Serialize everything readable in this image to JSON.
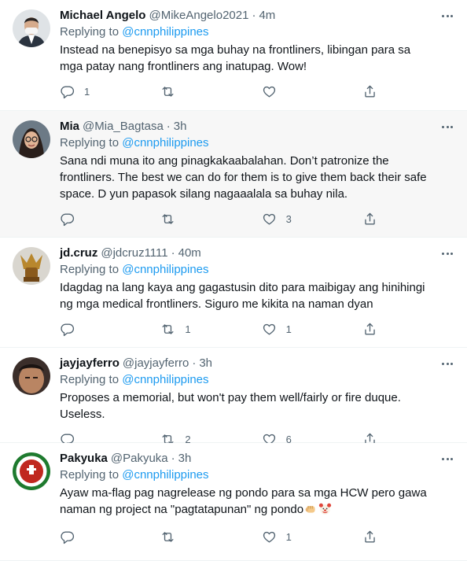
{
  "tweets": [
    {
      "name": "Michael Angelo",
      "handle": "@MikeAngelo2021",
      "sep": "·",
      "time": "4m",
      "replying_prefix": "Replying to ",
      "replying_to": "@cnnphilippines",
      "text": "Instead na benepisyo sa mga buhay na frontliners, libingan para sa mga patay nang frontliners ang inatupag. Wow!",
      "replies": "1",
      "retweets": "",
      "likes": ""
    },
    {
      "name": "Mia",
      "handle": "@Mia_Bagtasa",
      "sep": "·",
      "time": "3h",
      "replying_prefix": "Replying to ",
      "replying_to": "@cnnphilippines",
      "text": "Sana ndi muna ito ang pinagkakaabalahan. Don’t patronize the frontliners. The best we can do for them is to give them back their safe space. D yun papasok silang nagaaalala sa buhay nila.",
      "replies": "",
      "retweets": "",
      "likes": "3"
    },
    {
      "name": "jd.cruz",
      "handle": "@jdcruz1111",
      "sep": "·",
      "time": "40m",
      "replying_prefix": "Replying to ",
      "replying_to": "@cnnphilippines",
      "text": "Idagdag na lang kaya ang gagastusin dito para maibigay ang hinihingi ng mga medical frontliners. Siguro me kikita na naman dyan",
      "replies": "",
      "retweets": "1",
      "likes": "1"
    },
    {
      "name": "jayjayferro",
      "handle": "@jayjayferro",
      "sep": "·",
      "time": "3h",
      "replying_prefix": "Replying to ",
      "replying_to": "@cnnphilippines",
      "text": "Proposes a memorial, but won't pay them well/fairly or fire duque. Useless.",
      "replies": "",
      "retweets": "2",
      "likes": "6"
    },
    {
      "name": "Pakyuka",
      "handle": "@Pakyuka",
      "sep": "·",
      "time": "3h",
      "replying_prefix": "Replying to ",
      "replying_to": "@cnnphilippines",
      "text": "Ayaw ma-flag pag nagrelease ng pondo para sa mga HCW pero gawa naman ng project na \"pagtatapunan\" ng pondo",
      "replies": "",
      "retweets": "",
      "likes": "1"
    }
  ],
  "colors": {
    "accent": "#1d9bf0",
    "muted": "#536471",
    "highlight_bg": "#f7f7f7"
  },
  "icons": [
    "reply-icon",
    "retweet-icon",
    "like-icon",
    "share-icon",
    "more-icon"
  ],
  "emoji": [
    "fist-emoji",
    "clown-emoji"
  ]
}
